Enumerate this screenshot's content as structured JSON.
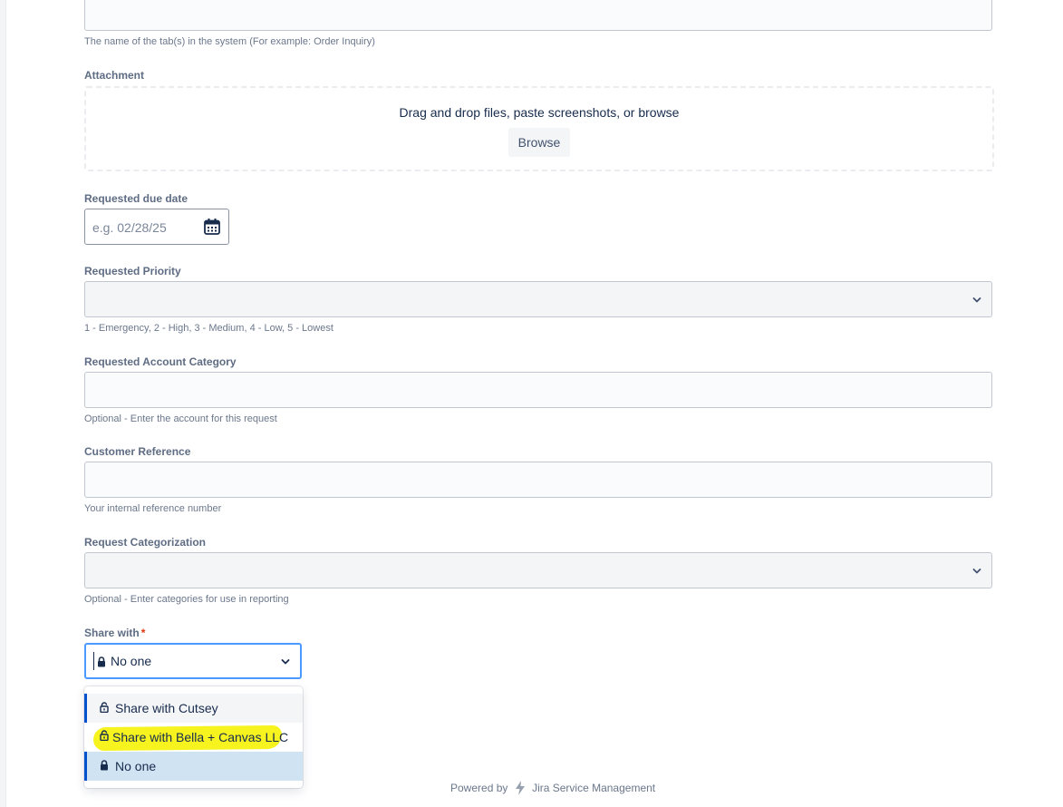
{
  "tab_field": {
    "value": "",
    "help": "The name of the tab(s) in the system (For example: Order Inquiry)"
  },
  "attachment": {
    "label": "Attachment",
    "drop_text": "Drag and drop files, paste screenshots, or browse",
    "browse_label": "Browse"
  },
  "due_date": {
    "label": "Requested due date",
    "placeholder": "e.g. 02/28/25"
  },
  "priority": {
    "label": "Requested Priority",
    "value": "",
    "help": "1 - Emergency, 2 - High, 3 - Medium, 4 - Low, 5 - Lowest"
  },
  "account_category": {
    "label": "Requested Account Category",
    "value": "",
    "help": "Optional - Enter the account for this request"
  },
  "customer_reference": {
    "label": "Customer Reference",
    "value": "",
    "help": "Your internal reference number"
  },
  "categorization": {
    "label": "Request Categorization",
    "value": "",
    "help": "Optional - Enter categories for use in reporting"
  },
  "share_with": {
    "label": "Share with",
    "required_mark": "*",
    "value": "No one",
    "options": [
      {
        "label": "Share with Cutsey",
        "icon": "unlock-icon"
      },
      {
        "label": "Share with Bella + Canvas LLC",
        "icon": "unlock-icon"
      },
      {
        "label": "No one",
        "icon": "lock-icon"
      }
    ]
  },
  "footer": {
    "powered_by": "Powered by",
    "product": "Jira Service Management"
  },
  "colors": {
    "focus": "#4c9aff",
    "selected_bg": "#cfe3f2",
    "accent": "#0052cc",
    "highlight": "#f6f31f",
    "required": "#de350b"
  }
}
